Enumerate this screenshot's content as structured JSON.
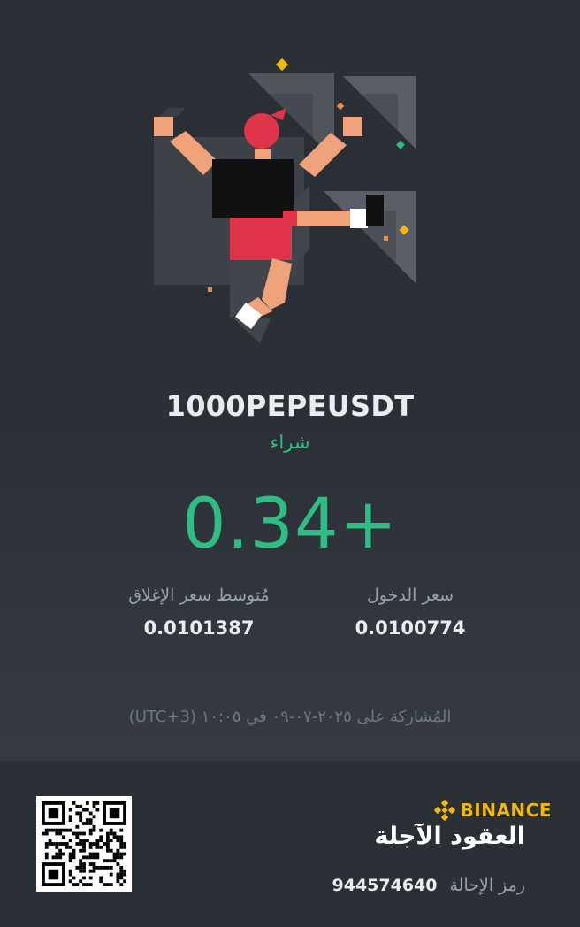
{
  "trade": {
    "symbol": "1000PEPEUSDT",
    "side": "شراء",
    "pnl": "0.34+"
  },
  "stats": {
    "entry_label": "سعر الدخول",
    "entry_value": "0.0100774",
    "close_label": "مُتوسط سعر الإغلاق",
    "close_value": "0.0101387"
  },
  "shared_text": "المُشاركة على ٢٠٢٥-٠٧-٠٩ في ١٠:٠٥ (UTC+3)",
  "footer": {
    "brand": "BINANCE",
    "product": "العقود الآجلة",
    "referral_label": "رمز الإحالة",
    "referral_code": "944574640"
  },
  "colors": {
    "positive": "#2ebd85",
    "brand": "#f0b90b",
    "background": "#2b2f36"
  }
}
